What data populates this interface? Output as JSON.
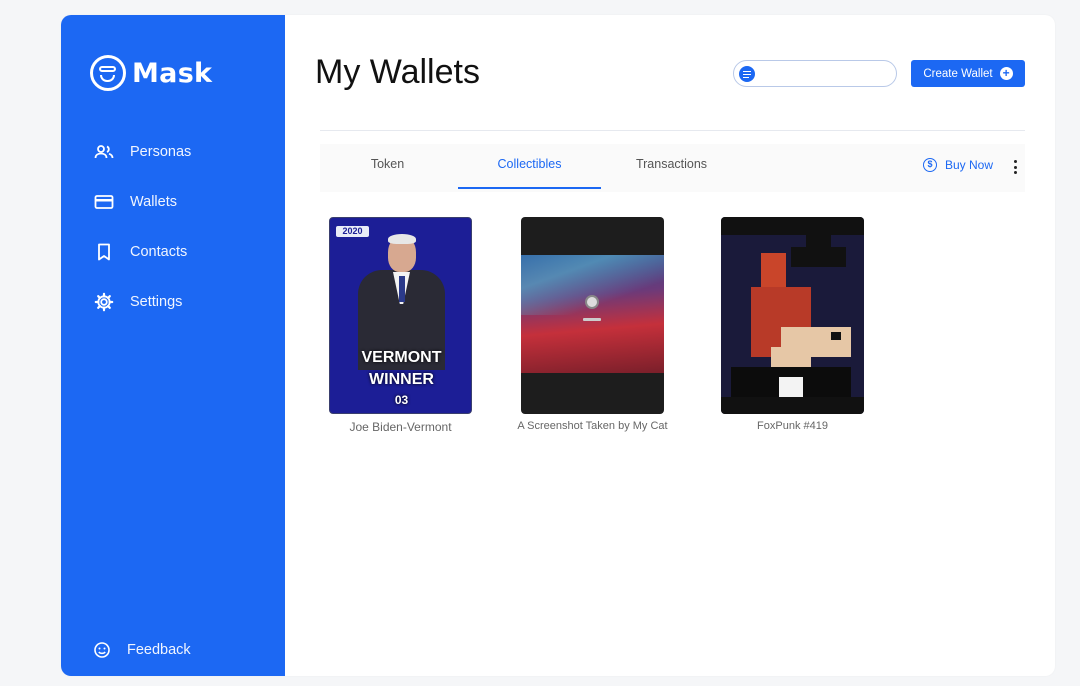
{
  "app": {
    "logo_text": "Mask"
  },
  "sidebar": {
    "items": [
      {
        "label": "Personas",
        "icon": "personas-icon"
      },
      {
        "label": "Wallets",
        "icon": "wallet-icon"
      },
      {
        "label": "Contacts",
        "icon": "bookmark-icon"
      },
      {
        "label": "Settings",
        "icon": "gear-icon"
      }
    ],
    "feedback_label": "Feedback"
  },
  "header": {
    "title": "My Wallets",
    "search_placeholder": "",
    "create_label": "Create Wallet"
  },
  "tabs": {
    "items": [
      "Token",
      "Collectibles",
      "Transactions"
    ],
    "active": "Collectibles",
    "buy_now_label": "Buy Now"
  },
  "collectibles": [
    {
      "name": "Joe Biden-Vermont",
      "badge": "2020",
      "line1": "VERMONT",
      "line2": "WINNER",
      "line3": "03"
    },
    {
      "name": "A Screenshot Taken by My Cat"
    },
    {
      "name": "FoxPunk #419"
    }
  ],
  "colors": {
    "accent": "#1c68f3",
    "sidebar": "#1c68f3"
  }
}
